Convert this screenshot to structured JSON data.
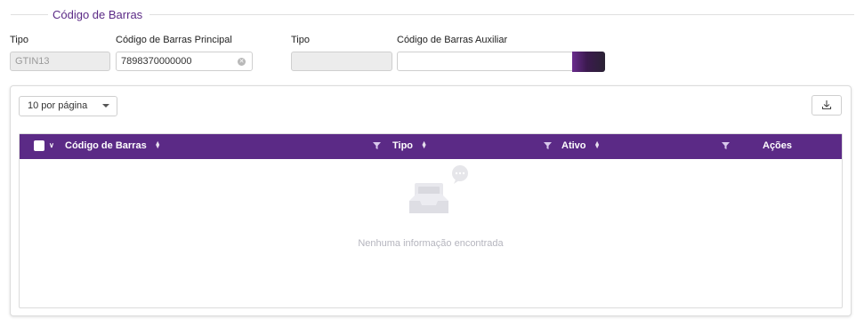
{
  "section": {
    "title": "Código de Barras"
  },
  "fields": {
    "tipo_label": "Tipo",
    "tipo_value": "GTIN13",
    "principal_label": "Código de Barras Principal",
    "principal_value": "7898370000000",
    "tipo2_label": "Tipo",
    "tipo2_value": "",
    "auxiliar_label": "Código de Barras Auxiliar",
    "auxiliar_value": ""
  },
  "table": {
    "page_size": "10 por página",
    "columns": [
      "Código de Barras",
      "Tipo",
      "Ativo",
      "Ações"
    ],
    "rows": [],
    "empty_message": "Nenhuma informação encontrada"
  },
  "icons": {
    "clear": "clear-icon",
    "export": "download-icon",
    "filter": "filter-icon",
    "sort": "sort-icon",
    "empty": "empty-inbox-icon"
  },
  "colors": {
    "accent": "#5b2a86",
    "header_text": "#ffffff",
    "disabled_bg": "#ececec",
    "empty_text": "#b5b5be"
  }
}
